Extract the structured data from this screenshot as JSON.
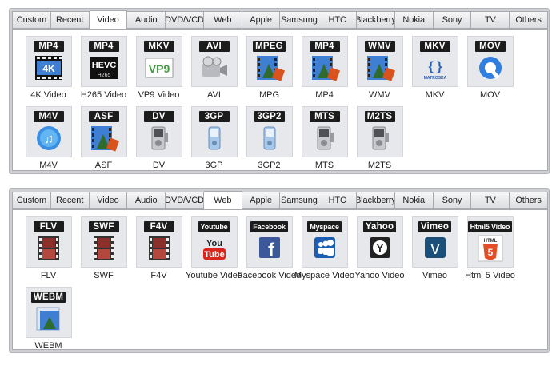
{
  "tabs": [
    "Custom",
    "Recent",
    "Video",
    "Audio",
    "DVD/VCD",
    "Web",
    "Apple",
    "Samsung",
    "HTC",
    "Blackberry",
    "Nokia",
    "Sony",
    "TV",
    "Others"
  ],
  "panel1": {
    "active_tab": "Video",
    "items": [
      {
        "badge": "MP4",
        "art": "4K",
        "label": "4K Video",
        "icon": "film-4k-icon"
      },
      {
        "badge": "MP4",
        "art": "HEVC",
        "sub": "H265",
        "label": "H265 Video",
        "icon": "hevc-icon"
      },
      {
        "badge": "MKV",
        "art": "VP9",
        "label": "VP9 Video",
        "icon": "vp9-icon"
      },
      {
        "badge": "AVI",
        "label": "AVI",
        "icon": "film-camera-icon"
      },
      {
        "badge": "MPEG",
        "label": "MPG",
        "icon": "film-clapper-icon"
      },
      {
        "badge": "MP4",
        "label": "MP4",
        "icon": "film-clapper-icon"
      },
      {
        "badge": "WMV",
        "label": "WMV",
        "icon": "film-clapper-icon"
      },
      {
        "badge": "MKV",
        "art": "MATROSKA",
        "label": "MKV",
        "icon": "matroska-icon"
      },
      {
        "badge": "MOV",
        "label": "MOV",
        "icon": "quicktime-icon"
      },
      {
        "badge": "M4V",
        "label": "M4V",
        "icon": "itunes-icon"
      },
      {
        "badge": "ASF",
        "label": "ASF",
        "icon": "film-clapper-icon"
      },
      {
        "badge": "DV",
        "label": "DV",
        "icon": "camcorder-icon"
      },
      {
        "badge": "3GP",
        "label": "3GP",
        "icon": "phone-icon"
      },
      {
        "badge": "3GP2",
        "label": "3GP2",
        "icon": "phone-icon"
      },
      {
        "badge": "MTS",
        "label": "MTS",
        "icon": "camcorder-icon"
      },
      {
        "badge": "M2TS",
        "label": "M2TS",
        "icon": "camcorder-icon"
      }
    ]
  },
  "panel2": {
    "active_tab": "Web",
    "items": [
      {
        "badge": "FLV",
        "label": "FLV",
        "icon": "film-strip-icon"
      },
      {
        "badge": "SWF",
        "label": "SWF",
        "icon": "film-strip-icon"
      },
      {
        "badge": "F4V",
        "label": "F4V",
        "icon": "film-strip-icon"
      },
      {
        "badge": "Youtube",
        "art": "You",
        "art2": "Tube",
        "label": "Youtube Video",
        "icon": "youtube-icon"
      },
      {
        "badge": "Facebook",
        "art": "f",
        "label": "Facebook Video",
        "icon": "facebook-icon"
      },
      {
        "badge": "Myspace",
        "label": "Myspace Video",
        "icon": "myspace-icon"
      },
      {
        "badge": "Yahoo",
        "art": "Y",
        "label": "Yahoo Video",
        "icon": "yahoo-icon"
      },
      {
        "badge": "Vimeo",
        "art": "v",
        "label": "Vimeo",
        "icon": "vimeo-icon"
      },
      {
        "badge": "Html5 Video",
        "art": "5",
        "sub": "HTML",
        "label": "Html 5 Video",
        "icon": "html5-icon"
      },
      {
        "badge": "WEBM",
        "label": "WEBM",
        "icon": "webm-icon"
      }
    ]
  },
  "colors": {
    "youtube": "#d9251c",
    "facebook": "#3b5998",
    "myspace": "#1a5fb4",
    "yahoo": "#222222",
    "vimeo": "#1a4f7a",
    "html5": "#e44d26",
    "film": "#8b2f2a",
    "sky": "#3e7fd3",
    "gray": "#6c6c72"
  }
}
